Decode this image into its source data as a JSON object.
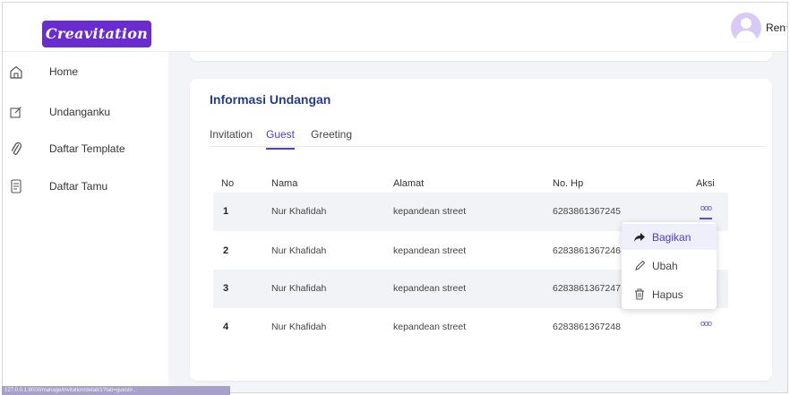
{
  "app": {
    "logo_text": "Creavitation",
    "user_name": "Ren",
    "user_chevron": "⌄"
  },
  "sidebar": {
    "items": [
      {
        "label": "Home",
        "icon": "home-icon"
      },
      {
        "label": "Undanganku",
        "icon": "edit-icon"
      },
      {
        "label": "Daftar Template",
        "icon": "paperclip-icon"
      },
      {
        "label": "Daftar Tamu",
        "icon": "contacts-icon"
      }
    ]
  },
  "card": {
    "title": "Informasi Undangan",
    "tabs": [
      {
        "label": "Invitation"
      },
      {
        "label": "Guest"
      },
      {
        "label": "Greeting"
      }
    ],
    "active_tab": "Guest"
  },
  "table": {
    "headers": {
      "no": "No",
      "nama": "Nama",
      "alamat": "Alamat",
      "hp": "No. Hp",
      "aksi": "Aksi"
    },
    "rows": [
      {
        "no": "1",
        "nama": "Nur Khafidah",
        "alamat": "kepandean street",
        "hp": "6283861367245",
        "aksi": "ooo"
      },
      {
        "no": "2",
        "nama": "Nur Khafidah",
        "alamat": "kepandean street",
        "hp": "6283861367246",
        "aksi": "ooo"
      },
      {
        "no": "3",
        "nama": "Nur Khafidah",
        "alamat": "kepandean street",
        "hp": "6283861367247",
        "aksi": "ooo"
      },
      {
        "no": "4",
        "nama": "Nur Khafidah",
        "alamat": "kepandean street",
        "hp": "6283861367248",
        "aksi": "ooo"
      }
    ]
  },
  "dropdown": {
    "items": [
      {
        "label": "Bagikan",
        "icon": "share-icon"
      },
      {
        "label": "Ubah",
        "icon": "pencil-icon"
      },
      {
        "label": "Hapus",
        "icon": "trash-icon"
      }
    ]
  },
  "status_bar": {
    "text": "127.0.0.1:8000/manage/invitation/detail/1?tab=guest#..."
  },
  "colors": {
    "brand": "#6a2bd1",
    "accent": "#4f3ae0",
    "title": "#233a8e",
    "content_bg": "#f3f4f8"
  }
}
